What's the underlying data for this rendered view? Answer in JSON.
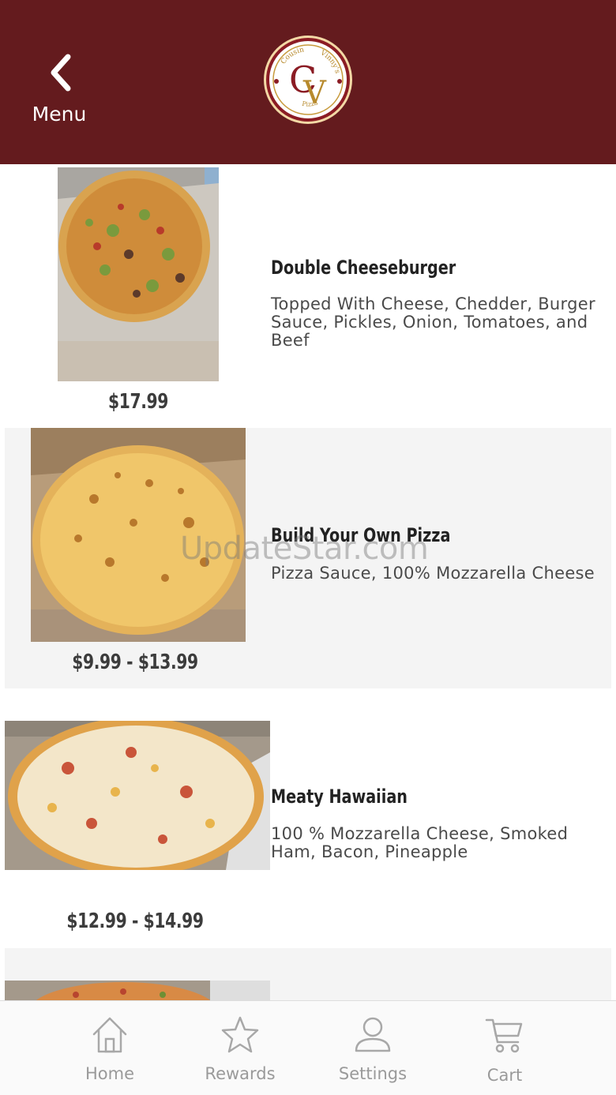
{
  "header": {
    "back_label": "Menu",
    "logo": {
      "icon": "cousin-vinnys-pizza-logo",
      "brand_top": "Cousin",
      "brand_right": "Vinny's",
      "brand_bottom": "Pizza",
      "monogram_c": "C",
      "monogram_v": "V"
    },
    "background_color": "#641b1e"
  },
  "items": [
    {
      "name": "Double Cheeseburger",
      "description": "Topped With Cheese, Chedder, Burger Sauce, Pickles, Onion, Tomatoes, and Beef",
      "price": "$17.99",
      "image": "cheeseburger-pizza-photo"
    },
    {
      "name": "Build Your Own Pizza",
      "description": "Pizza Sauce, 100% Mozzarella Cheese",
      "price": "$9.99 - $13.99",
      "image": "cheese-pizza-photo"
    },
    {
      "name": "Meaty Hawaiian",
      "description": "100 % Mozzarella Cheese, Smoked Ham, Bacon, Pineapple",
      "price": "$12.99 - $14.99",
      "image": "hawaiian-pizza-photo"
    },
    {
      "image": "pizza-photo"
    }
  ],
  "watermark": "UpdateStar.com",
  "tabs": [
    {
      "label": "Home",
      "icon": "home-icon"
    },
    {
      "label": "Rewards",
      "icon": "star-icon"
    },
    {
      "label": "Settings",
      "icon": "user-icon"
    },
    {
      "label": "Cart",
      "icon": "cart-icon"
    }
  ]
}
